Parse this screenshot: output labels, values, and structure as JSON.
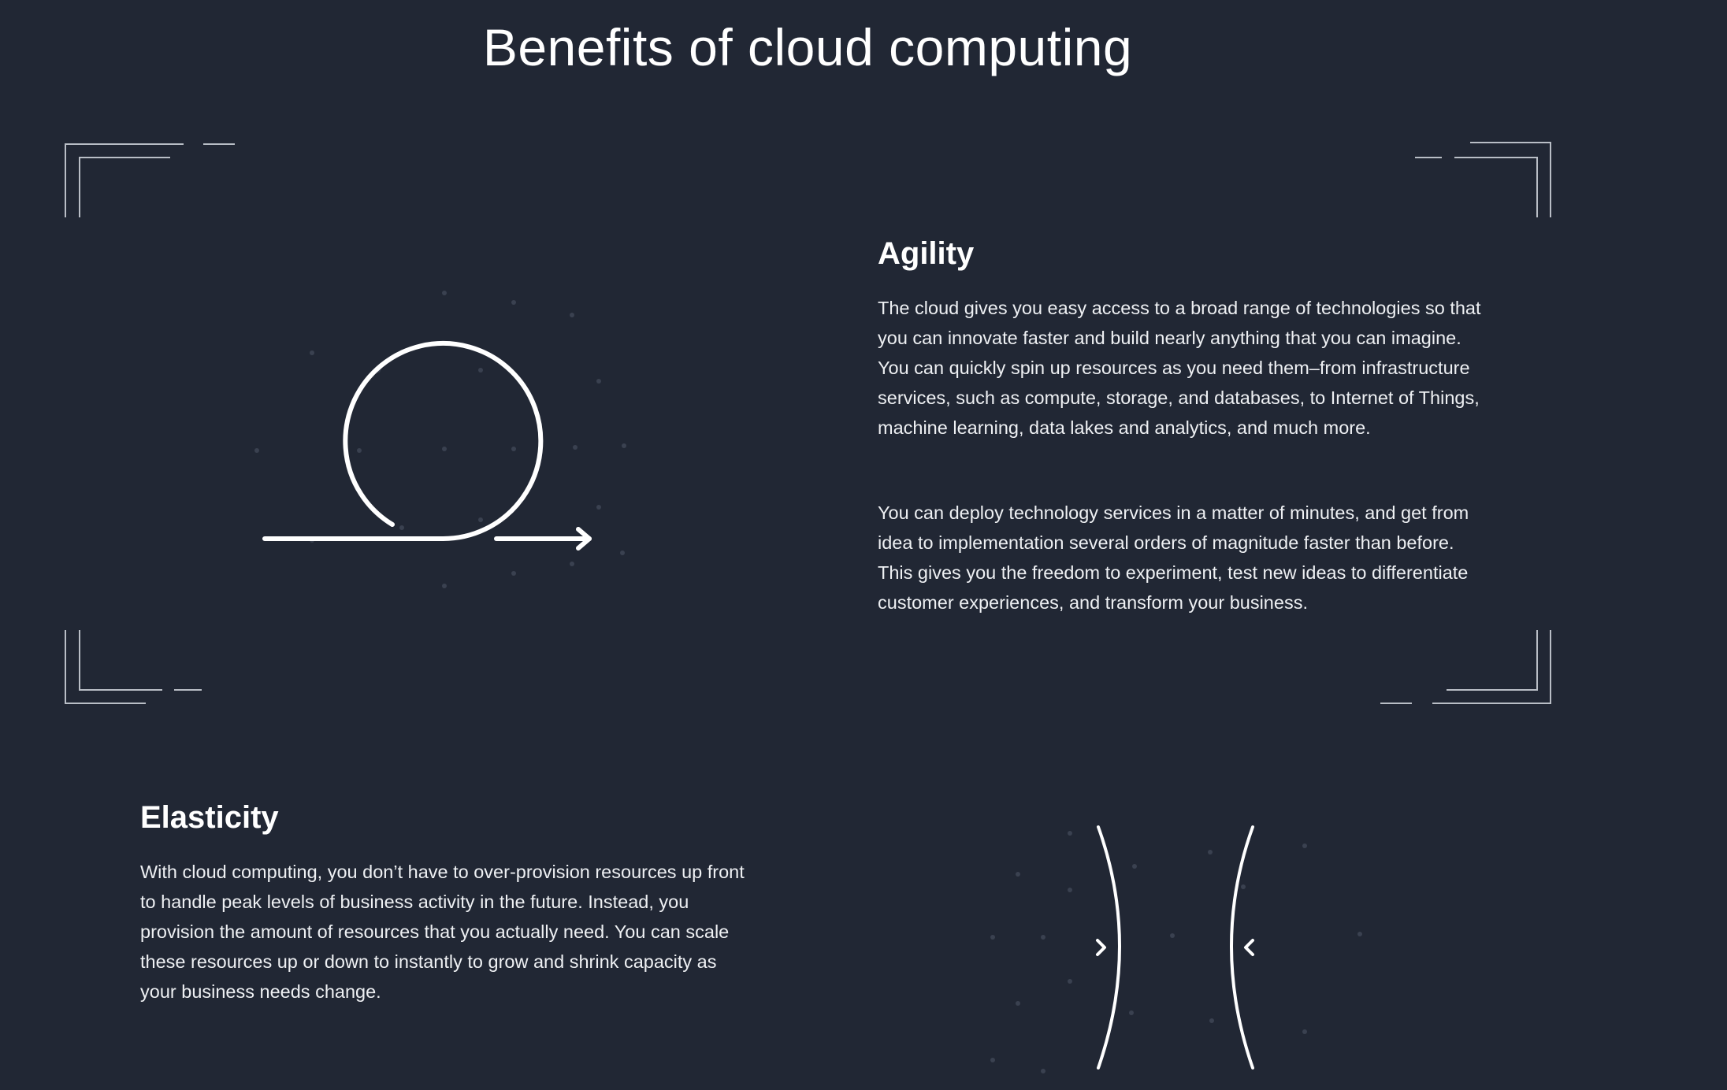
{
  "page": {
    "title": "Benefits of cloud computing"
  },
  "sections": [
    {
      "heading": "Agility",
      "paragraphs": [
        "The cloud gives you easy access to a broad range of technologies so that you can innovate faster and build nearly anything that you can imagine. You can quickly spin up resources as you need them–from infrastructure services, such as compute, storage, and databases, to Internet of Things, machine learning, data lakes and analytics, and much more.",
        "You can deploy technology services in a matter of minutes, and get from idea to implementation several orders of magnitude faster than before. This gives you the freedom to experiment, test new ideas to differentiate customer experiences, and transform your business."
      ],
      "icon": "loop-arrow-icon"
    },
    {
      "heading": "Elasticity",
      "paragraphs": [
        "With cloud computing, you don’t have to over-provision resources up front to handle peak levels of business activity in the future. Instead, you provision the amount of resources that you actually need. You can scale these resources up or down to instantly to grow and shrink capacity as your business needs change."
      ],
      "icon": "scale-brackets-icon"
    }
  ],
  "colors": {
    "background": "#212734",
    "foreground": "#ffffff",
    "frame": "#b9bec6",
    "dots": "#3a4150"
  }
}
